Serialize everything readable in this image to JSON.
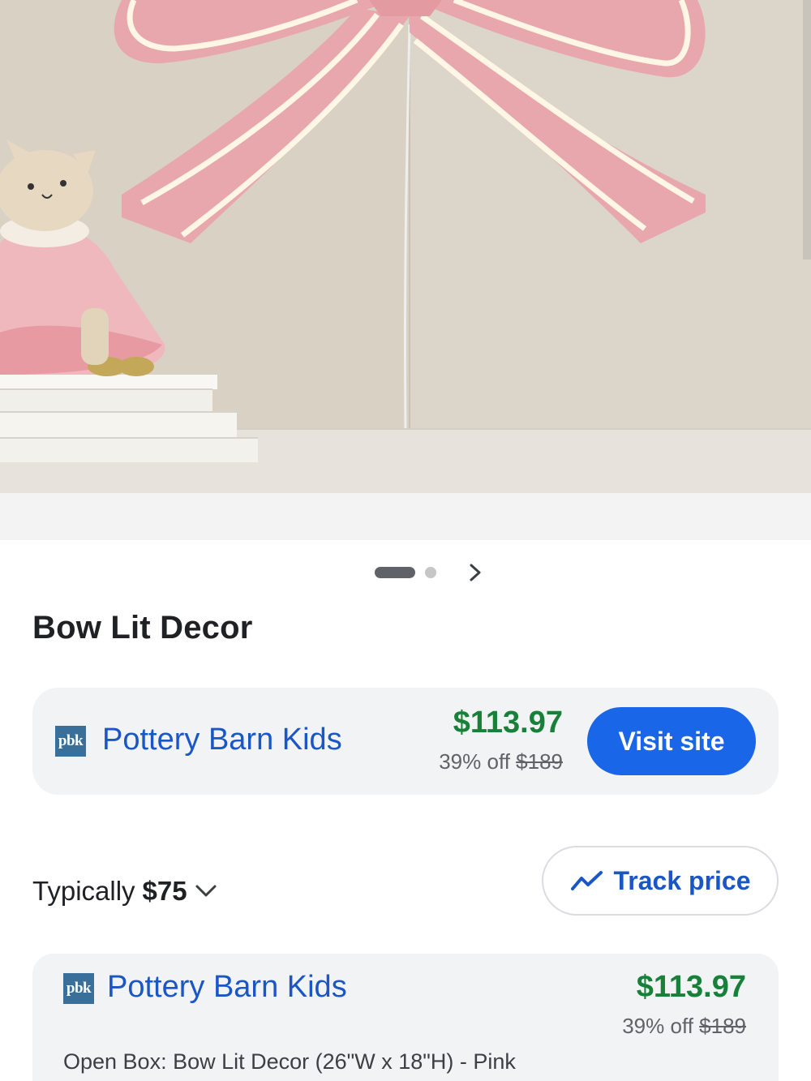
{
  "product": {
    "title": "Bow Lit Decor"
  },
  "carousel": {
    "total_images": 2,
    "active_index": 0
  },
  "offer": {
    "logo_text": "pbk",
    "store": "Pottery Barn Kids",
    "price": "$113.97",
    "discount": "39% off",
    "original_price": "$189",
    "visit_label": "Visit site"
  },
  "price_history": {
    "typical_label": "Typically",
    "typical_value": "$75",
    "track_label": "Track price"
  },
  "listing": {
    "logo_text": "pbk",
    "store": "Pottery Barn Kids",
    "price": "$113.97",
    "discount": "39% off",
    "original_price": "$189",
    "description": "Open Box: Bow Lit Decor (26\"W x 18\"H) - Pink"
  },
  "colors": {
    "price_green": "#188038",
    "link_blue": "#1a56c5",
    "button_blue": "#1a66e8",
    "card_bg": "#f1f3f4",
    "bow_pink": "#e8a7ad",
    "logo_blue": "#3a6f9a"
  },
  "icons": {
    "next": "chevron-right-icon",
    "expand": "chevron-down-icon",
    "track": "trending-line-icon"
  }
}
